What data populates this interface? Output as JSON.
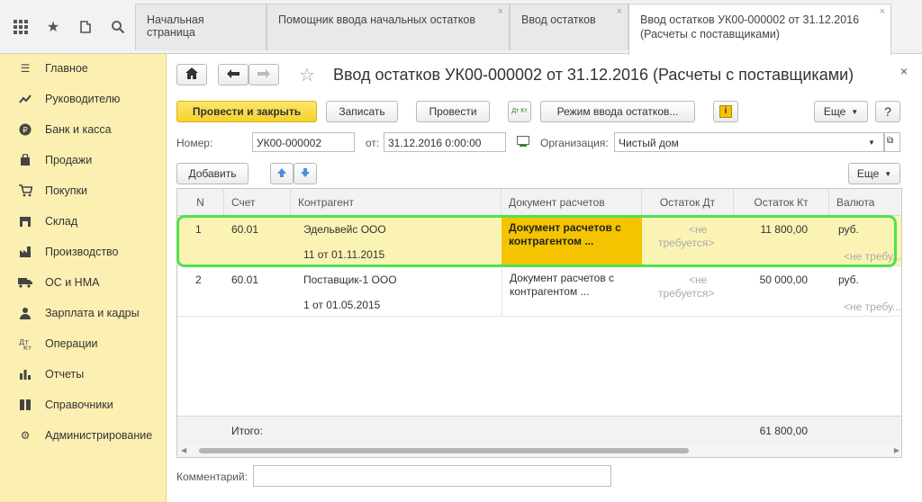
{
  "tabs": [
    {
      "label": "Начальная страница"
    },
    {
      "label": "Помощник ввода начальных остатков",
      "close": "×"
    },
    {
      "label": "Ввод остатков",
      "close": "×"
    },
    {
      "line1": "Ввод остатков УК00-000002 от 31.12.2016",
      "line2": "(Расчеты с поставщиками)",
      "close": "×"
    }
  ],
  "sidebar": {
    "items": [
      {
        "label": "Главное",
        "icon": "menu-icon"
      },
      {
        "label": "Руководителю",
        "icon": "chart-line-icon"
      },
      {
        "label": "Банк и касса",
        "icon": "ruble-icon"
      },
      {
        "label": "Продажи",
        "icon": "bag-icon"
      },
      {
        "label": "Покупки",
        "icon": "cart-icon"
      },
      {
        "label": "Склад",
        "icon": "warehouse-icon"
      },
      {
        "label": "Производство",
        "icon": "factory-icon"
      },
      {
        "label": "ОС и НМА",
        "icon": "truck-icon"
      },
      {
        "label": "Зарплата и кадры",
        "icon": "person-icon"
      },
      {
        "label": "Операции",
        "icon": "operations-icon"
      },
      {
        "label": "Отчеты",
        "icon": "bar-chart-icon"
      },
      {
        "label": "Справочники",
        "icon": "book-icon"
      },
      {
        "label": "Администрирование",
        "icon": "gear-icon"
      }
    ]
  },
  "document": {
    "title": "Ввод остатков УК00-000002 от 31.12.2016 (Расчеты с поставщиками)",
    "close": "×"
  },
  "toolbar": {
    "post_close": "Провести и закрыть",
    "save": "Записать",
    "post": "Провести",
    "mode": "Режим ввода остатков...",
    "more": "Еще",
    "help": "?",
    "dtkt": "Дт Кт"
  },
  "form": {
    "number_label": "Номер:",
    "number_value": "УК00-000002",
    "date_label": "от:",
    "date_value": "31.12.2016  0:00:00",
    "org_label": "Организация:",
    "org_value": "Чистый дом"
  },
  "table_toolbar": {
    "add": "Добавить",
    "more": "Еще"
  },
  "table": {
    "columns": [
      "N",
      "Счет",
      "Контрагент",
      "Документ расчетов",
      "Остаток Дт",
      "Остаток Кт",
      "Валюта"
    ],
    "rows": [
      {
        "n": "1",
        "account": "60.01",
        "counterparty": "Эдельвейс ООО",
        "contract": "11 от 01.11.2015",
        "doc_line1": "Документ расчетов с",
        "doc_line2": "контрагентом ...",
        "dt_line1": "<не",
        "dt_line2": "требуется>",
        "kt": "11 800,00",
        "currency": "руб.",
        "currency_extra": "<не требу..."
      },
      {
        "n": "2",
        "account": "60.01",
        "counterparty": "Поставщик-1 ООО",
        "contract": "1 от 01.05.2015",
        "doc_line1": "Документ расчетов с",
        "doc_line2": "контрагентом ...",
        "dt_line1": "<не",
        "dt_line2": "требуется>",
        "kt": "50 000,00",
        "currency": "руб.",
        "currency_extra": "<не требу..."
      }
    ],
    "total_label": "Итого:",
    "total_value": "61 800,00"
  },
  "comment": {
    "label": "Комментарий:",
    "value": ""
  },
  "colors": {
    "accent_yellow": "#f5d22e",
    "sidebar_bg": "#fbf0b2",
    "selection": "#fbf3b4",
    "highlight_green": "#4ee24e"
  }
}
